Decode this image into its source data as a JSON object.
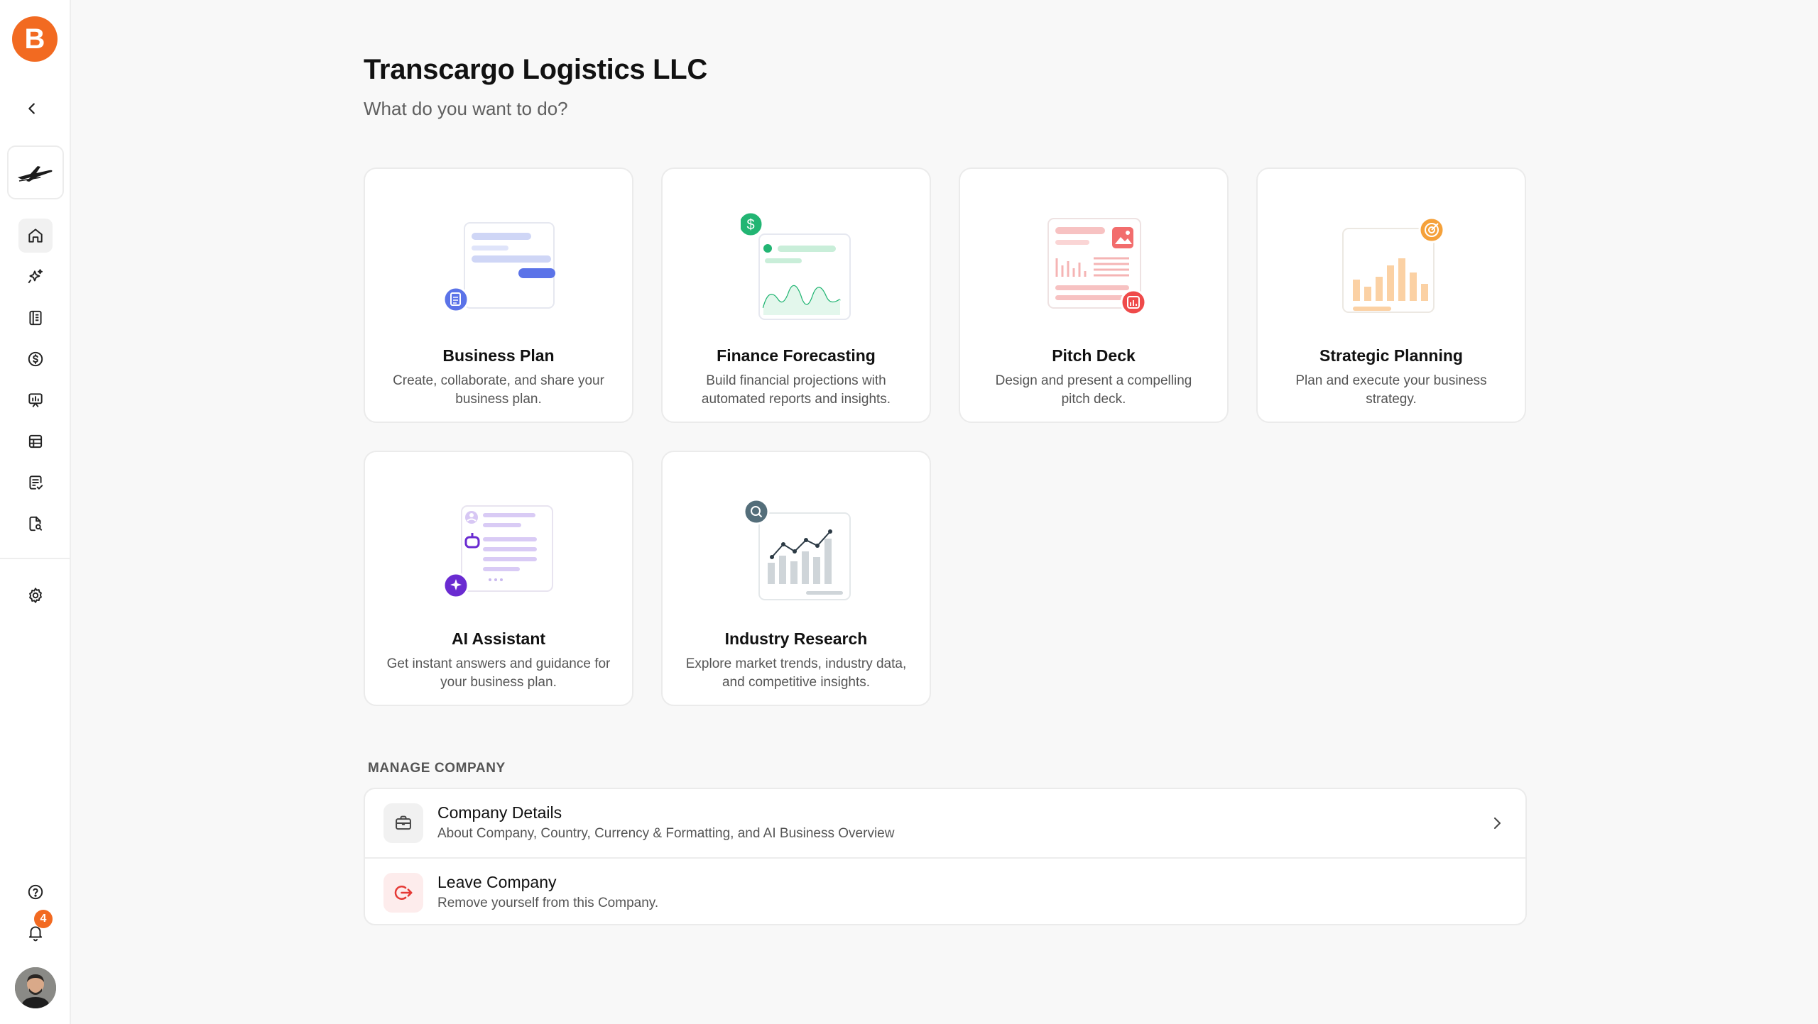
{
  "sidebar": {
    "brand_letter": "B",
    "notifications_count": "4",
    "nav": [
      "home-icon",
      "sparkles-icon",
      "plan-book-icon",
      "dollar-icon",
      "presentation-icon",
      "table-icon",
      "checklist-icon",
      "document-search-icon"
    ]
  },
  "header": {
    "title": "Transcargo Logistics LLC",
    "subtitle": "What do you want to do?"
  },
  "cards": [
    {
      "title": "Business Plan",
      "description": "Create, collaborate, and share your business plan.",
      "accent": "#5b73e8"
    },
    {
      "title": "Finance Forecasting",
      "description": "Build financial projections with automated reports and insights.",
      "accent": "#22b573",
      "badge": "$"
    },
    {
      "title": "Pitch Deck",
      "description": "Design and present a compelling pitch deck.",
      "accent": "#ef4a4a"
    },
    {
      "title": "Strategic Planning",
      "description": "Plan and execute your business strategy.",
      "accent": "#f5a13a"
    },
    {
      "title": "AI Assistant",
      "description": "Get instant answers and guidance for your business plan.",
      "accent": "#6a2bd1"
    },
    {
      "title": "Industry Research",
      "description": "Explore market trends, industry data, and competitive insights.",
      "accent": "#546e7a"
    }
  ],
  "manage": {
    "label": "MANAGE COMPANY",
    "rows": [
      {
        "title": "Company Details",
        "description": "About Company, Country, Currency & Formatting, and AI Business Overview"
      },
      {
        "title": "Leave Company",
        "description": "Remove yourself from this Company."
      }
    ]
  },
  "colors": {
    "brand": "#f26a21",
    "danger": "#e53935"
  }
}
